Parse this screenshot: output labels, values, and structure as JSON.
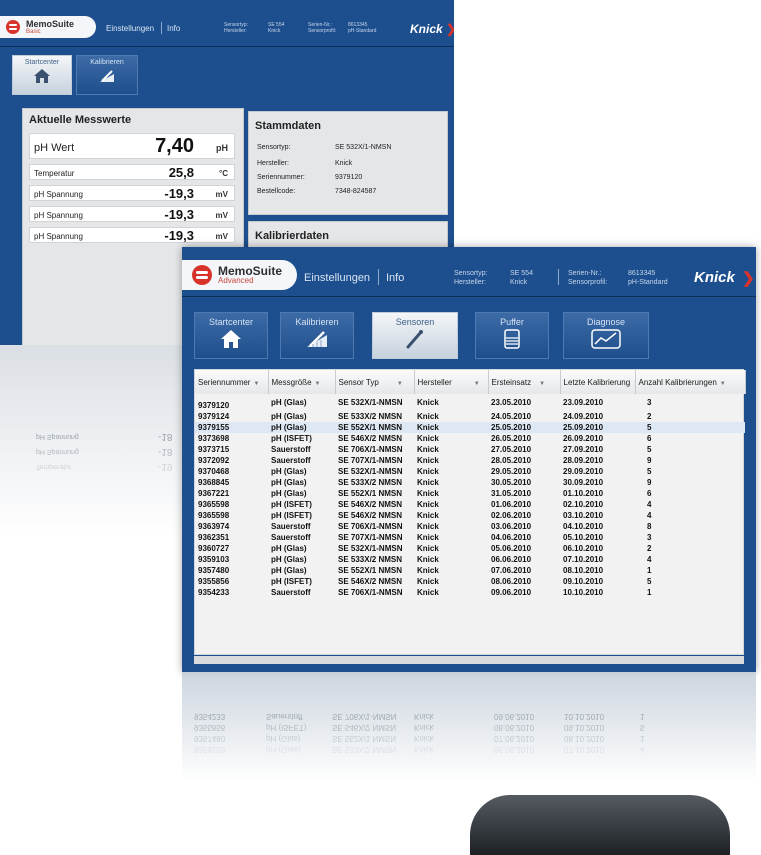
{
  "back": {
    "header": {
      "brand": "MemoSuite",
      "edition": "Basic",
      "nav_links": [
        "Einstellungen",
        "Info"
      ],
      "meta_labels_1": [
        "Sensortyp:",
        "Hersteller:"
      ],
      "meta_values_1": [
        "SE 554",
        "Knick"
      ],
      "meta_labels_2": [
        "Serien-Nr.:",
        "Sensorprofil:"
      ],
      "meta_values_2": [
        "8613345",
        "pH-Standard"
      ],
      "brand_right": "Knick"
    },
    "tabs": [
      {
        "label": "Startcenter",
        "icon": "home-icon",
        "active": true
      },
      {
        "label": "Kalibrieren",
        "icon": "calibrate-icon",
        "active": false
      }
    ],
    "measurements": {
      "title": "Aktuelle Messwerte",
      "rows": [
        {
          "name": "pH Wert",
          "value": "7,40",
          "unit": "pH"
        },
        {
          "name": "Temperatur",
          "value": "25,8",
          "unit": "°C"
        },
        {
          "name": "pH Spannung",
          "value": "-19,3",
          "unit": "mV"
        },
        {
          "name": "pH Spannung",
          "value": "-19,3",
          "unit": "mV"
        },
        {
          "name": "pH Spannung",
          "value": "-19,3",
          "unit": "mV"
        }
      ]
    },
    "stammdaten": {
      "title": "Stammdaten",
      "rows": [
        {
          "key": "Sensortyp:",
          "value": "SE 532X/1-NMSN"
        },
        {
          "key": "Hersteller:",
          "value": "Knick"
        },
        {
          "key": "Seriennummer:",
          "value": "9379120"
        },
        {
          "key": "Bestellcode:",
          "value": "7348-824587"
        }
      ]
    },
    "kalibrierdaten": {
      "title": "Kalibrierdaten"
    },
    "reflection": [
      {
        "name": "pH Spannung",
        "value": "-18"
      },
      {
        "name": "pH Spannung",
        "value": "-18"
      },
      {
        "name": "Temperatur",
        "value": "-19"
      }
    ]
  },
  "front": {
    "header": {
      "brand": "MemoSuite",
      "edition": "Advanced",
      "nav_links": [
        "Einstellungen",
        "Info"
      ],
      "meta_labels_1": [
        "Sensortyp:",
        "Hersteller:"
      ],
      "meta_values_1": [
        "SE 554",
        "Knick"
      ],
      "meta_labels_2": [
        "Serien-Nr.:",
        "Sensorprofil:"
      ],
      "meta_values_2": [
        "8613345",
        "pH-Standard"
      ],
      "brand_right": "Knick"
    },
    "tabs": [
      {
        "label": "Startcenter",
        "icon": "home-icon",
        "active": false
      },
      {
        "label": "Kalibrieren",
        "icon": "calibrate-icon",
        "active": false
      },
      {
        "label": "Sensoren",
        "icon": "sensor-icon",
        "active": true
      },
      {
        "label": "Puffer",
        "icon": "buffer-icon",
        "active": false
      },
      {
        "label": "Diagnose",
        "icon": "diagnose-icon",
        "active": false
      }
    ],
    "table": {
      "columns": [
        "Seriennummer",
        "Messgröße",
        "Sensor Typ",
        "Hersteller",
        "Ersteinsatz",
        "Letzte Kalibrierung",
        "Anzahl Kalibrierungen"
      ],
      "selected_row": 2,
      "rows": [
        [
          "9379120",
          "pH (Glas)",
          "SE 532X/1-NMSN",
          "Knick",
          "23.05.2010",
          "23.09.2010",
          "3"
        ],
        [
          "9379124",
          "pH (Glas)",
          "SE 533X/2 NMSN",
          "Knick",
          "24.05.2010",
          "24.09.2010",
          "2"
        ],
        [
          "9379155",
          "pH (Glas)",
          "SE 552X/1 NMSN",
          "Knick",
          "25.05.2010",
          "25.09.2010",
          "5"
        ],
        [
          "9373698",
          "pH (ISFET)",
          "SE 546X/2 NMSN",
          "Knick",
          "26.05.2010",
          "26.09.2010",
          "6"
        ],
        [
          "9373715",
          "Sauerstoff",
          "SE 706X/1-NMSN",
          "Knick",
          "27.05.2010",
          "27.09.2010",
          "5"
        ],
        [
          "9372092",
          "Sauerstoff",
          "SE 707X/1-NMSN",
          "Knick",
          "28.05.2010",
          "28.09.2010",
          "9"
        ],
        [
          "9370468",
          "pH (Glas)",
          "SE 532X/1-NMSN",
          "Knick",
          "29.05.2010",
          "29.09.2010",
          "5"
        ],
        [
          "9368845",
          "pH (Glas)",
          "SE 533X/2 NMSN",
          "Knick",
          "30.05.2010",
          "30.09.2010",
          "9"
        ],
        [
          "9367221",
          "pH (Glas)",
          "SE 552X/1 NMSN",
          "Knick",
          "31.05.2010",
          "01.10.2010",
          "6"
        ],
        [
          "9365598",
          "pH (ISFET)",
          "SE 546X/2 NMSN",
          "Knick",
          "01.06.2010",
          "02.10.2010",
          "4"
        ],
        [
          "9365598",
          "pH (ISFET)",
          "SE 546X/2 NMSN",
          "Knick",
          "02.06.2010",
          "03.10.2010",
          "4"
        ],
        [
          "9363974",
          "Sauerstoff",
          "SE 706X/1-NMSN",
          "Knick",
          "03.06.2010",
          "04.10.2010",
          "8"
        ],
        [
          "9362351",
          "Sauerstoff",
          "SE 707X/1-NMSN",
          "Knick",
          "04.06.2010",
          "05.10.2010",
          "3"
        ],
        [
          "9360727",
          "pH (Glas)",
          "SE 532X/1-NMSN",
          "Knick",
          "05.06.2010",
          "06.10.2010",
          "2"
        ],
        [
          "9359103",
          "pH (Glas)",
          "SE 533X/2 NMSN",
          "Knick",
          "06.06.2010",
          "07.10.2010",
          "4"
        ],
        [
          "9357480",
          "pH (Glas)",
          "SE 552X/1 NMSN",
          "Knick",
          "07.06.2010",
          "08.10.2010",
          "1"
        ],
        [
          "9355856",
          "pH (ISFET)",
          "SE 546X/2 NMSN",
          "Knick",
          "08.06.2010",
          "09.10.2010",
          "5"
        ],
        [
          "9354233",
          "Sauerstoff",
          "SE 706X/1-NMSN",
          "Knick",
          "09.06.2010",
          "10.10.2010",
          "1"
        ]
      ]
    },
    "reflection": [
      [
        "9354233",
        "Sauerstoff",
        "SE 706X/1-NMSN",
        "Knick",
        "09.06.2010",
        "10.10.2010",
        "1"
      ],
      [
        "9355856",
        "pH (ISFET)",
        "SE 546X/2 NMSN",
        "Knick",
        "08.06.2010",
        "09.10.2010",
        "5"
      ],
      [
        "9357480",
        "pH (Glas)",
        "SE 552X/1 NMSN",
        "Knick",
        "07.06.2010",
        "08.10.2010",
        "1"
      ],
      [
        "9359103",
        "pH (Glas)",
        "SE 533X/2 NMSN",
        "Knick",
        "06.06.2010",
        "07.10.2010",
        "4"
      ]
    ]
  },
  "colors": {
    "app_blue": "#1d4f8e",
    "brand_red": "#d8332a",
    "selected_row": "#dde8f4"
  }
}
